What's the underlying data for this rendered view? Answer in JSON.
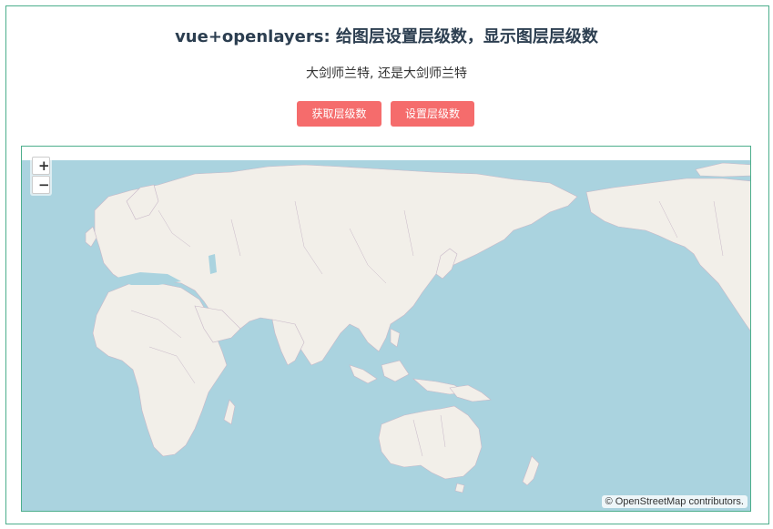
{
  "header": {
    "title": "vue+openlayers: 给图层设置层级数，显示图层层级数",
    "subtitle": "大剑师兰特, 还是大剑师兰特"
  },
  "buttons": {
    "get_level": "获取层级数",
    "set_level": "设置层级数"
  },
  "map": {
    "zoom_in": "+",
    "zoom_out": "−",
    "attribution_prefix": "©",
    "attribution_link": "OpenStreetMap",
    "attribution_suffix": " contributors."
  },
  "colors": {
    "accent_button": "#f56c6c",
    "frame_border": "#4cae8c",
    "ocean": "#aad3df",
    "land": "#f2efe9",
    "border_line": "#c8b8c8"
  }
}
